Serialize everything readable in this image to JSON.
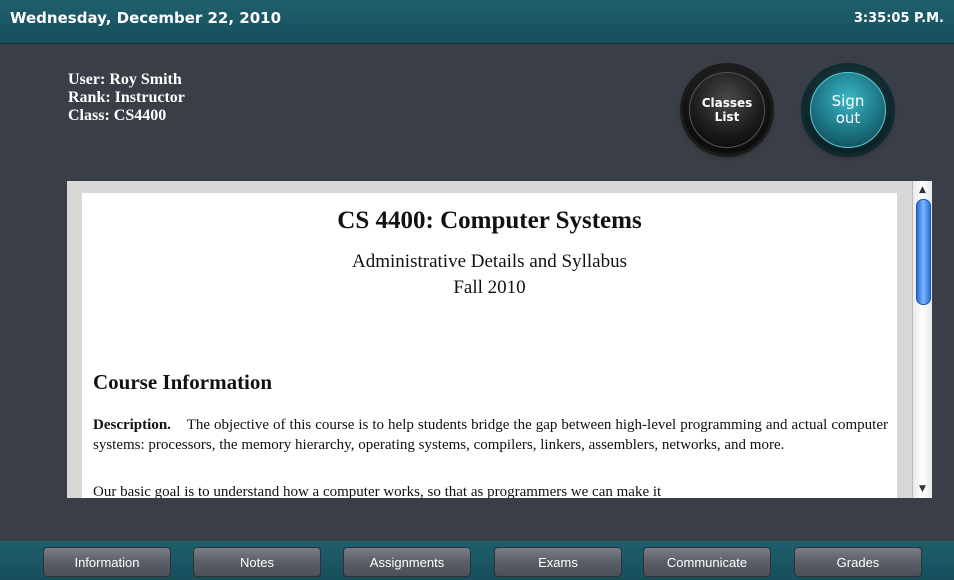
{
  "header": {
    "date": "Wednesday, December 22, 2010",
    "time": "3:35:05 P.M."
  },
  "user": {
    "name": "User: Roy Smith",
    "rank": "Rank: Instructor",
    "class": "Class: CS4400"
  },
  "buttons": {
    "classes_list": [
      "Classes",
      "List"
    ],
    "sign_out": [
      "Sign",
      "out"
    ]
  },
  "document": {
    "title": "CS 4400: Computer Systems",
    "subtitle": "Administrative Details and Syllabus",
    "term": "Fall 2010",
    "section_heading": "Course Information",
    "description_label": "Description.",
    "description_text": "The objective of this course is to help students bridge the gap between high-level programming and actual computer systems: processors, the memory hierarchy, operating systems, compilers, linkers, assemblers, networks, and more.",
    "next_line": "Our basic goal is to understand how a computer works, so that as programmers we can make it"
  },
  "scrollbar": {
    "up_icon": "▲",
    "down_icon": "▼"
  },
  "nav": [
    "Information",
    "Notes",
    "Assignments",
    "Exams",
    "Communicate",
    "Grades"
  ],
  "colors": {
    "bar": "#1f5f6d",
    "background": "#3a3f47",
    "thumb": "#2a6fd6",
    "signout": "#1a6e7c"
  }
}
